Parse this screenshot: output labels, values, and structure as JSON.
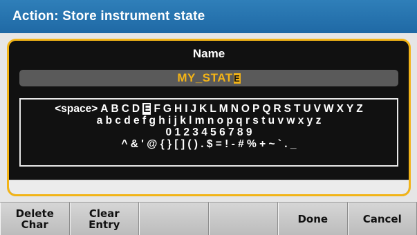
{
  "title": "Action: Store instrument state",
  "dialog": {
    "name_label": "Name",
    "name_value": "MY_STAT",
    "cursor_char": "E"
  },
  "keyboard": {
    "row1": [
      "<space>",
      "A",
      "B",
      "C",
      "D",
      "E",
      "F",
      "G",
      "H",
      "I",
      "J",
      "K",
      "L",
      "M",
      "N",
      "O",
      "P",
      "Q",
      "R",
      "S",
      "T",
      "U",
      "V",
      "W",
      "X",
      "Y",
      "Z"
    ],
    "row2": "a b c d e f g h i j k l m n o p q r s t u v w x y z",
    "row3": "0 1 2 3 4 5 6 7 8 9",
    "row4": "^ & ' @ { } [ ] ( ) . $ = ! - # % + ~ ` . _",
    "selected": "E"
  },
  "softkeys": [
    {
      "label": "Delete\nChar"
    },
    {
      "label": "Clear\nEntry"
    },
    {
      "label": ""
    },
    {
      "label": ""
    },
    {
      "label": "Done"
    },
    {
      "label": "Cancel"
    }
  ]
}
